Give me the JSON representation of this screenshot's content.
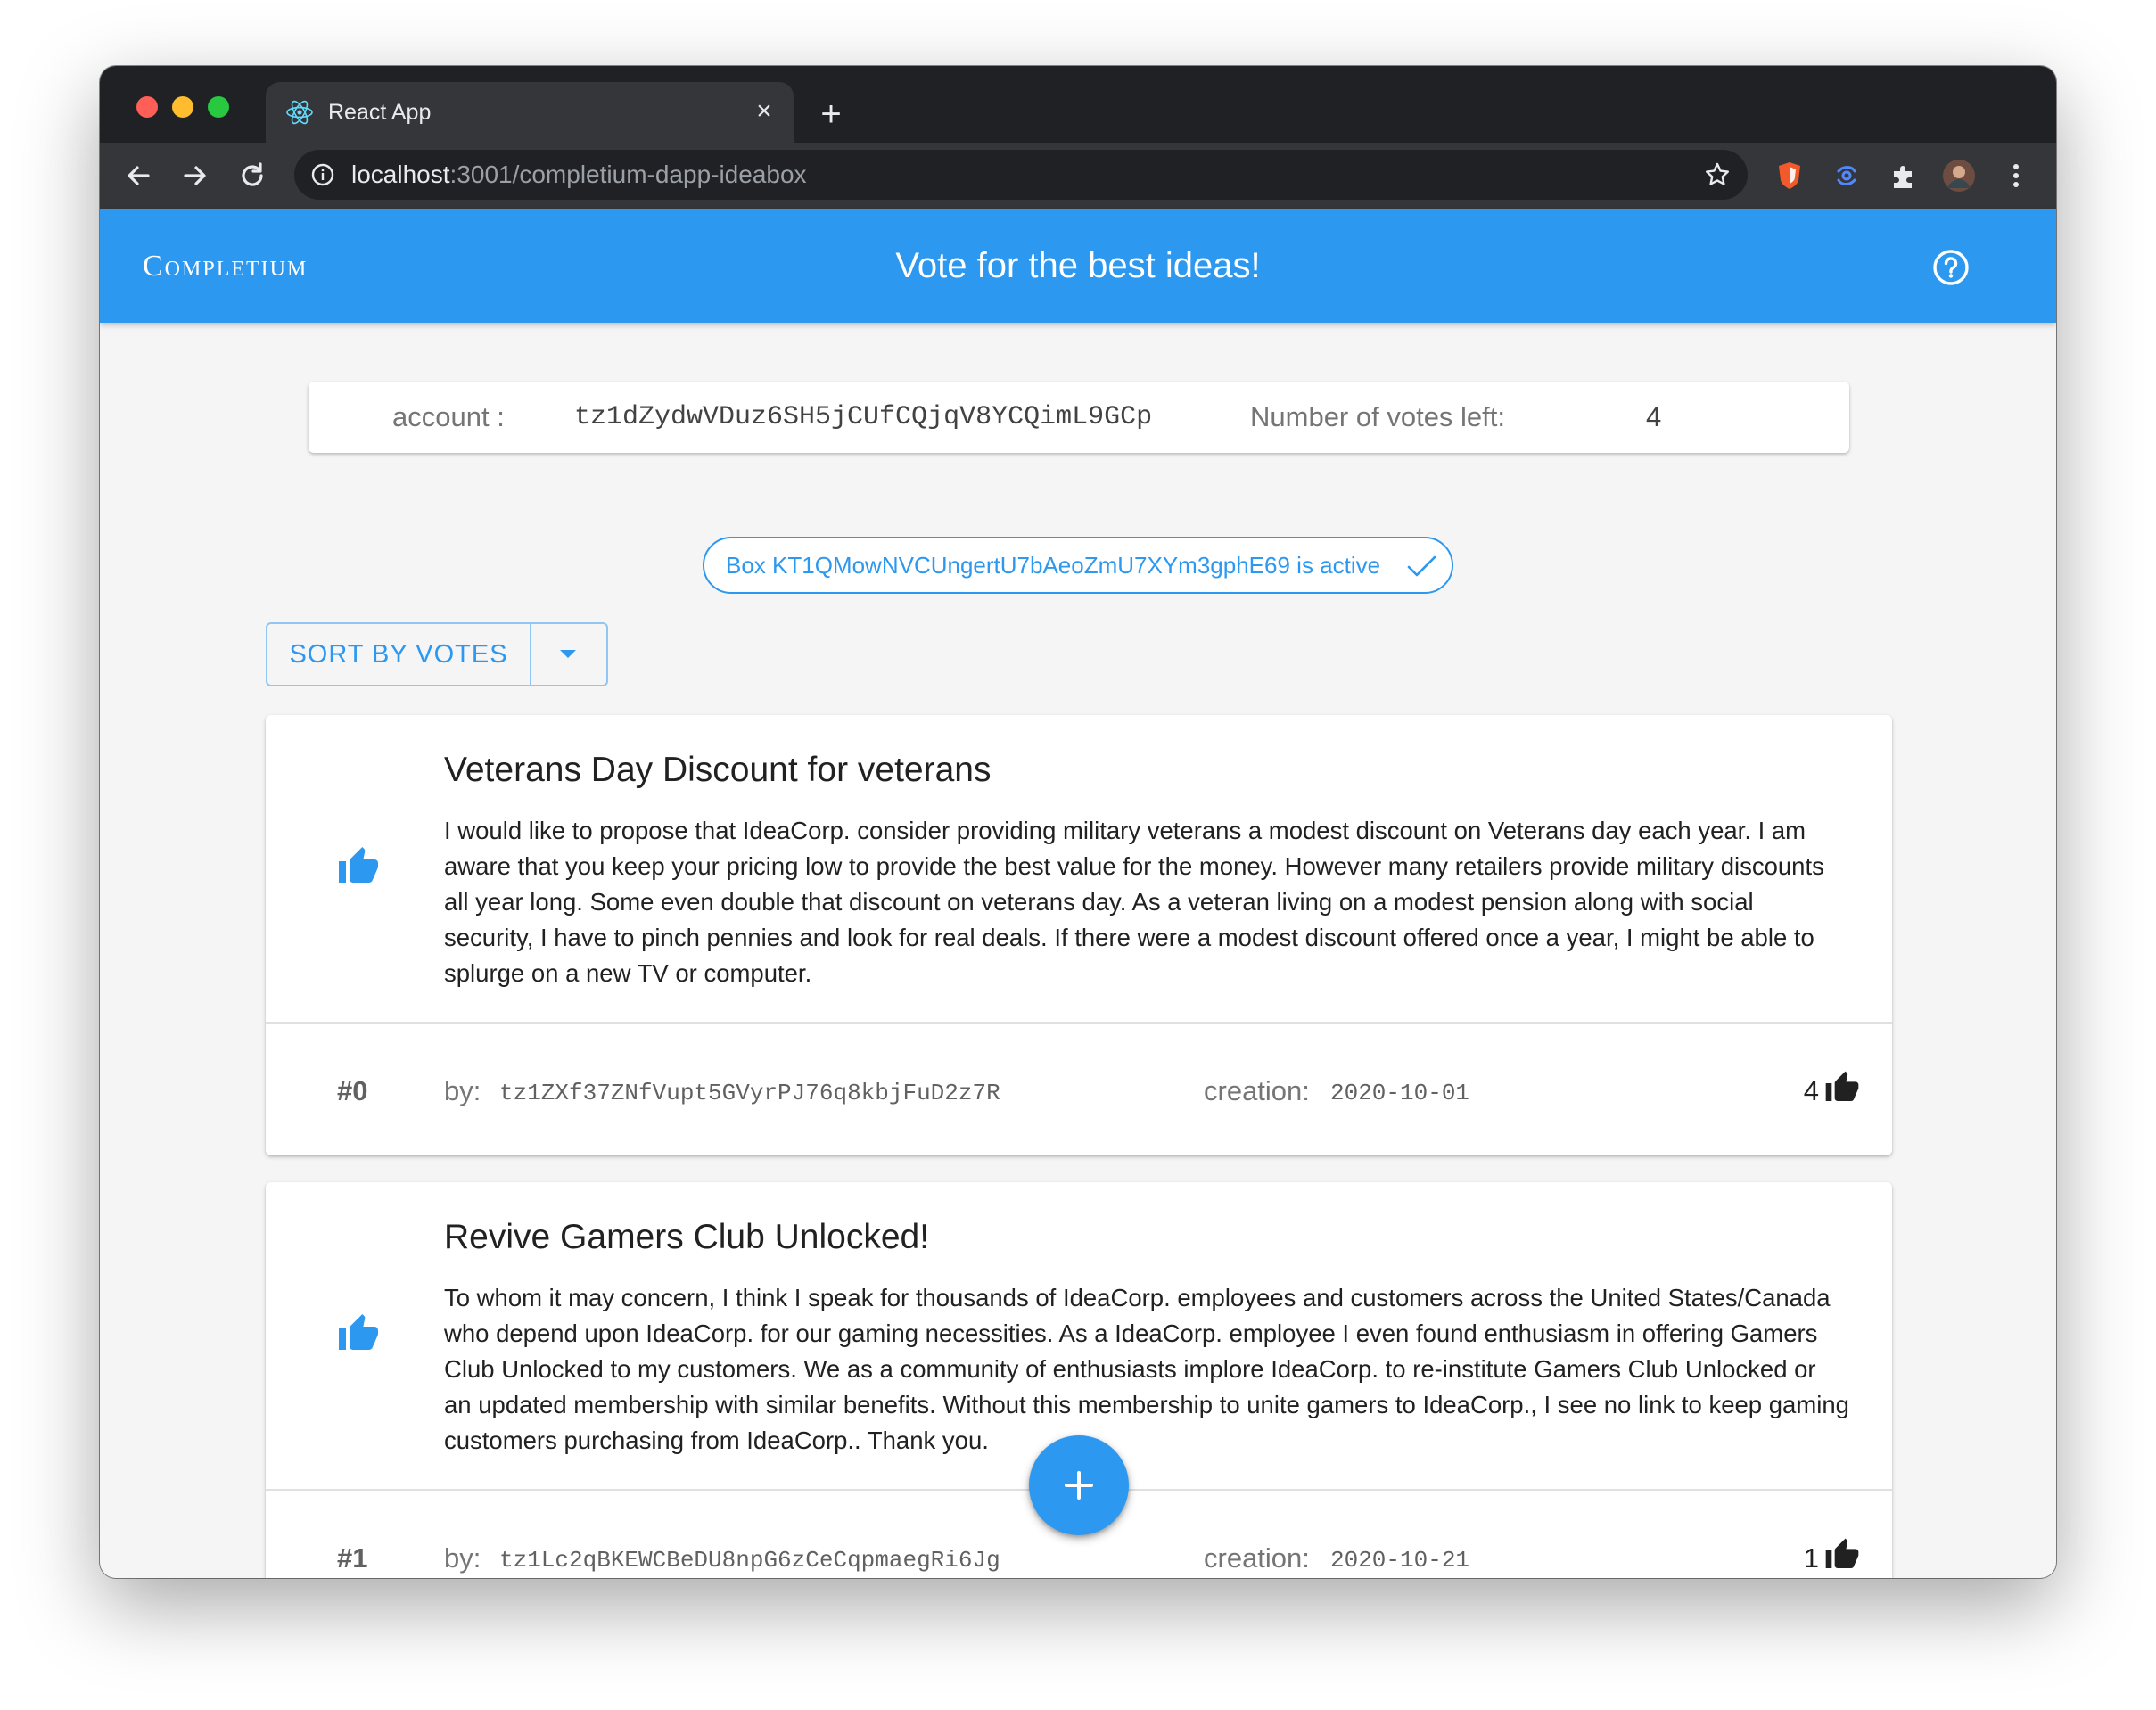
{
  "browser": {
    "tab_title": "React App",
    "url_host": "localhost",
    "url_rest": ":3001/completium-dapp-ideabox"
  },
  "appbar": {
    "brand": "Completium",
    "headline": "Vote for the best ideas!"
  },
  "account": {
    "label": "account :",
    "address": "tz1dZydwVDuz6SH5jCUfCQjqV8YCQimL9GCp",
    "votes_label": "Number of votes left:",
    "votes_left": "4"
  },
  "box_chip": {
    "label": "Box KT1QMowNVCUngertU7bAeoZmU7XYm3gphE69 is active"
  },
  "sort": {
    "label": "SORT BY VOTES"
  },
  "ideas": [
    {
      "title": "Veterans Day Discount for veterans",
      "body": "I would like to propose that IdeaCorp. consider providing military veterans a modest discount on Veterans day each year. I am aware that you keep your pricing low to provide the best value for the money. However many retailers provide military discounts all year long. Some even double that discount on veterans day. As a veteran living on a modest pension along with social security, I have to pinch pennies and look for real deals. If there were a modest discount offered once a year, I might be able to splurge on a new TV or computer.",
      "index": "#0",
      "by_label": "by:",
      "author": "tz1ZXf37ZNfVupt5GVyrPJ76q8kbjFuD2z7R",
      "creation_label": "creation:",
      "creation": "2020-10-01",
      "votes": "4"
    },
    {
      "title": "Revive Gamers Club Unlocked!",
      "body": "To whom it may concern, I think I speak for thousands of IdeaCorp. employees and customers across the United States/Canada who depend upon IdeaCorp. for our gaming necessities. As a IdeaCorp. employee I even found enthusiasm in offering Gamers Club Unlocked to my customers. We as a community of enthusiasts implore IdeaCorp. to re-institute Gamers Club Unlocked or an updated membership with similar benefits. Without this membership to unite gamers to IdeaCorp., I see no link to keep gaming customers purchasing from IdeaCorp.. Thank you.",
      "index": "#1",
      "by_label": "by:",
      "author": "tz1Lc2qBKEWCBeDU8npG6zCeCqpmaegRi6Jg",
      "creation_label": "creation:",
      "creation": "2020-10-21",
      "votes": "1"
    }
  ],
  "colors": {
    "primary": "#2c98f0",
    "background": "#f5f5f5"
  },
  "icons": {
    "tab_favicon": "react-icon",
    "help": "help-circle-icon",
    "vote": "thumb-up-icon",
    "chip": "check-icon",
    "fab": "plus-icon"
  }
}
